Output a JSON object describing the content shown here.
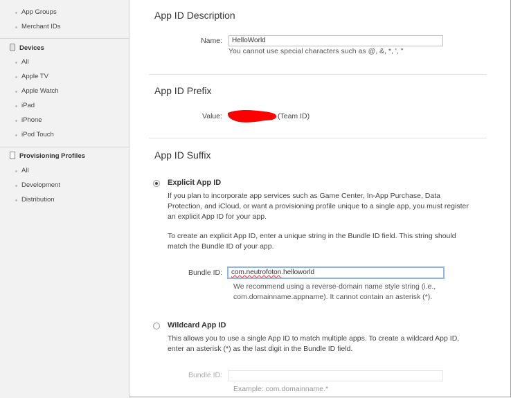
{
  "sidebar": {
    "identifiers_items": [
      "App Groups",
      "Merchant IDs"
    ],
    "devices": {
      "title": "Devices",
      "items": [
        "All",
        "Apple TV",
        "Apple Watch",
        "iPad",
        "iPhone",
        "iPod Touch"
      ]
    },
    "profiles": {
      "title": "Provisioning Profiles",
      "items": [
        "All",
        "Development",
        "Distribution"
      ]
    }
  },
  "description": {
    "heading": "App ID Description",
    "name_label": "Name:",
    "name_value": "HelloWorld",
    "name_help": "You cannot use special characters such as @, &, *, ', \""
  },
  "prefix": {
    "heading": "App ID Prefix",
    "value_label": "Value:",
    "team_suffix": "(Team ID)"
  },
  "suffix": {
    "heading": "App ID Suffix",
    "explicit": {
      "title": "Explicit App ID",
      "selected": true,
      "para1": "If you plan to incorporate app services such as Game Center, In-App Purchase, Data Protection, and iCloud, or want a provisioning profile unique to a single app, you must register an explicit App ID for your app.",
      "para2": "To create an explicit App ID, enter a unique string in the Bundle ID field. This string should match the Bundle ID of your app.",
      "bundle_label": "Bundle ID:",
      "bundle_value_a": "com.neutrofoton",
      "bundle_value_b": ".helloworld",
      "bundle_help": "We recommend using a reverse-domain name style string (i.e., com.domainname.appname). It cannot contain an asterisk (*)."
    },
    "wildcard": {
      "title": "Wildcard App ID",
      "selected": false,
      "para": "This allows you to use a single App ID to match multiple apps. To create a wildcard App ID, enter an asterisk (*) as the last digit in the Bundle ID field.",
      "bundle_label": "Bundle ID:",
      "bundle_example": "Example: com.domainname.*"
    }
  }
}
